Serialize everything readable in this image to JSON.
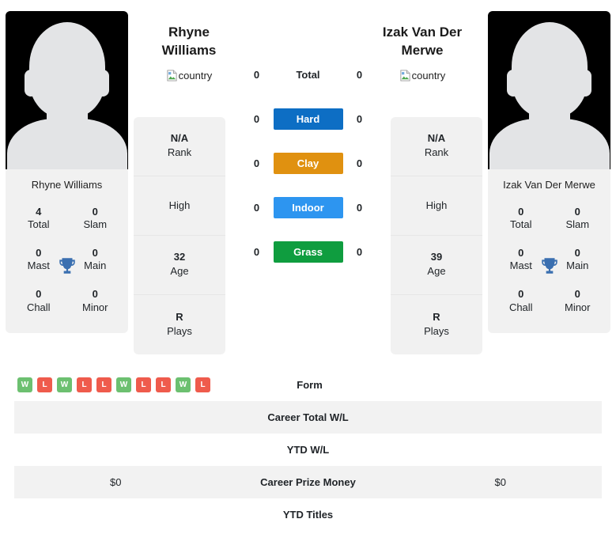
{
  "players": {
    "left": {
      "name": "Rhyne Williams",
      "photo_name": "Rhyne Williams",
      "country_alt": "country",
      "titles": [
        {
          "value": "4",
          "label": "Total"
        },
        {
          "value": "0",
          "label": "Slam"
        },
        {
          "value": "0",
          "label": "Mast"
        },
        {
          "value": "0",
          "label": "Main"
        },
        {
          "value": "0",
          "label": "Chall"
        },
        {
          "value": "0",
          "label": "Minor"
        }
      ],
      "info": [
        {
          "value": "N/A",
          "label": "Rank"
        },
        {
          "value": "",
          "label": "High"
        },
        {
          "value": "32",
          "label": "Age"
        },
        {
          "value": "R",
          "label": "Plays"
        }
      ]
    },
    "right": {
      "name": "Izak Van Der Merwe",
      "photo_name": "Izak Van Der Merwe",
      "country_alt": "country",
      "titles": [
        {
          "value": "0",
          "label": "Total"
        },
        {
          "value": "0",
          "label": "Slam"
        },
        {
          "value": "0",
          "label": "Mast"
        },
        {
          "value": "0",
          "label": "Main"
        },
        {
          "value": "0",
          "label": "Chall"
        },
        {
          "value": "0",
          "label": "Minor"
        }
      ],
      "info": [
        {
          "value": "N/A",
          "label": "Rank"
        },
        {
          "value": "",
          "label": "High"
        },
        {
          "value": "39",
          "label": "Age"
        },
        {
          "value": "R",
          "label": "Plays"
        }
      ]
    }
  },
  "surfaces": [
    {
      "label": "Total",
      "left": "0",
      "right": "0",
      "color": ""
    },
    {
      "label": "Hard",
      "left": "0",
      "right": "0",
      "color": "#0d6ec4"
    },
    {
      "label": "Clay",
      "left": "0",
      "right": "0",
      "color": "#e09110"
    },
    {
      "label": "Indoor",
      "left": "0",
      "right": "0",
      "color": "#2d95f0"
    },
    {
      "label": "Grass",
      "left": "0",
      "right": "0",
      "color": "#0f9d3f"
    }
  ],
  "form": {
    "left": [
      "W",
      "L",
      "W",
      "L",
      "L",
      "W",
      "L",
      "L",
      "W",
      "L"
    ],
    "right": []
  },
  "table_rows": [
    {
      "label": "Form",
      "left": "",
      "right": "",
      "shaded": false
    },
    {
      "label": "Career Total W/L",
      "left": "",
      "right": "",
      "shaded": true
    },
    {
      "label": "YTD W/L",
      "left": "",
      "right": "",
      "shaded": false
    },
    {
      "label": "Career Prize Money",
      "left": "$0",
      "right": "$0",
      "shaded": true
    },
    {
      "label": "YTD Titles",
      "left": "",
      "right": "",
      "shaded": false
    }
  ],
  "colors": {
    "win": "#6cc070",
    "loss": "#ef5b4c",
    "trophy": "#3a6fb0",
    "panel": "#f1f1f1",
    "row_shade": "#f2f2f2"
  }
}
